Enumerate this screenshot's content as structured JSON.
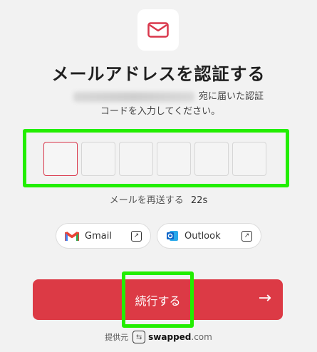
{
  "header": {
    "icon": "mail-icon",
    "title": "メールアドレスを認証する",
    "subtitle_line1_tail": "宛に届いた認証",
    "subtitle_line2": "コードを入力してください。"
  },
  "code_input": {
    "box_count": 6,
    "active_index": 0,
    "active_color": "#d9374b"
  },
  "resend": {
    "label": "メールを再送する",
    "timer": "22s"
  },
  "mail_apps": [
    {
      "label": "Gmail",
      "icon": "gmail-icon"
    },
    {
      "label": "Outlook",
      "icon": "outlook-icon"
    }
  ],
  "continue_button": {
    "label": "続行する",
    "arrow": "→",
    "color": "#dc3a45"
  },
  "footer": {
    "provider_label": "提供元",
    "brand": "swapped",
    "domain": ".com"
  },
  "highlight_color": "#22ee00"
}
